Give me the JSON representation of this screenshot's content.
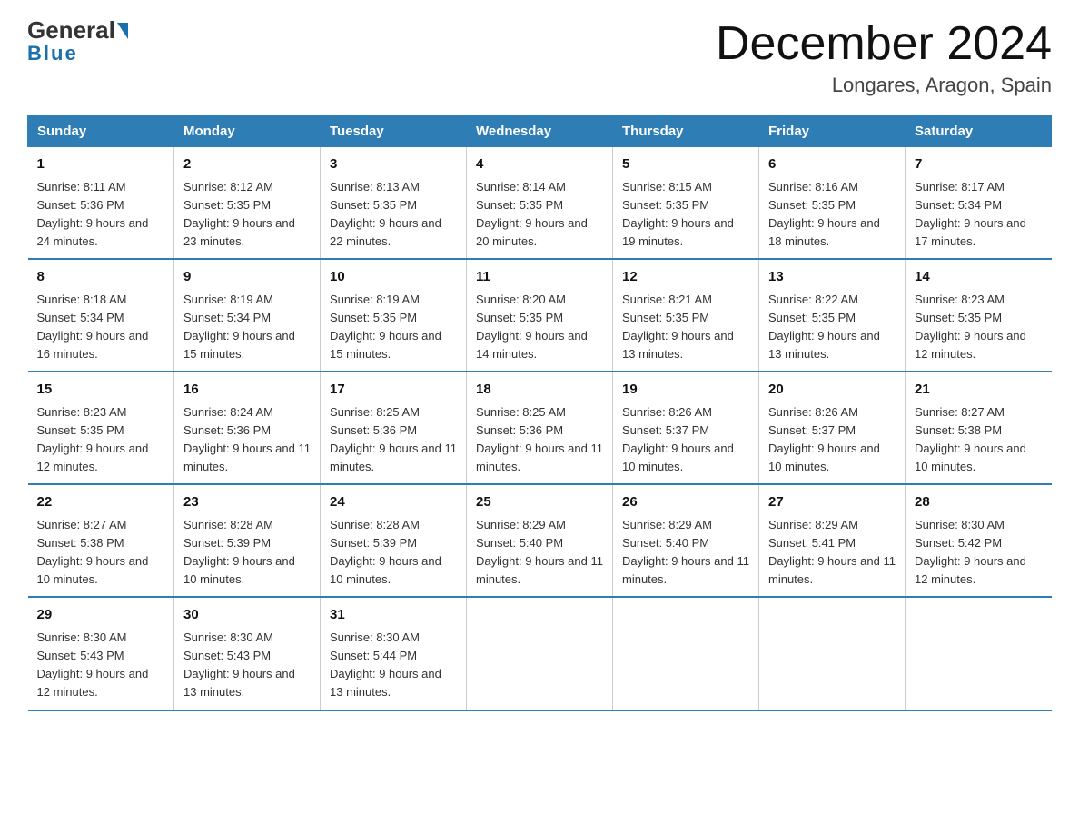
{
  "header": {
    "logo_general": "General",
    "logo_blue": "Blue",
    "title": "December 2024",
    "subtitle": "Longares, Aragon, Spain"
  },
  "days_of_week": [
    "Sunday",
    "Monday",
    "Tuesday",
    "Wednesday",
    "Thursday",
    "Friday",
    "Saturday"
  ],
  "weeks": [
    [
      {
        "day": "1",
        "sunrise": "8:11 AM",
        "sunset": "5:36 PM",
        "daylight": "9 hours and 24 minutes."
      },
      {
        "day": "2",
        "sunrise": "8:12 AM",
        "sunset": "5:35 PM",
        "daylight": "9 hours and 23 minutes."
      },
      {
        "day": "3",
        "sunrise": "8:13 AM",
        "sunset": "5:35 PM",
        "daylight": "9 hours and 22 minutes."
      },
      {
        "day": "4",
        "sunrise": "8:14 AM",
        "sunset": "5:35 PM",
        "daylight": "9 hours and 20 minutes."
      },
      {
        "day": "5",
        "sunrise": "8:15 AM",
        "sunset": "5:35 PM",
        "daylight": "9 hours and 19 minutes."
      },
      {
        "day": "6",
        "sunrise": "8:16 AM",
        "sunset": "5:35 PM",
        "daylight": "9 hours and 18 minutes."
      },
      {
        "day": "7",
        "sunrise": "8:17 AM",
        "sunset": "5:34 PM",
        "daylight": "9 hours and 17 minutes."
      }
    ],
    [
      {
        "day": "8",
        "sunrise": "8:18 AM",
        "sunset": "5:34 PM",
        "daylight": "9 hours and 16 minutes."
      },
      {
        "day": "9",
        "sunrise": "8:19 AM",
        "sunset": "5:34 PM",
        "daylight": "9 hours and 15 minutes."
      },
      {
        "day": "10",
        "sunrise": "8:19 AM",
        "sunset": "5:35 PM",
        "daylight": "9 hours and 15 minutes."
      },
      {
        "day": "11",
        "sunrise": "8:20 AM",
        "sunset": "5:35 PM",
        "daylight": "9 hours and 14 minutes."
      },
      {
        "day": "12",
        "sunrise": "8:21 AM",
        "sunset": "5:35 PM",
        "daylight": "9 hours and 13 minutes."
      },
      {
        "day": "13",
        "sunrise": "8:22 AM",
        "sunset": "5:35 PM",
        "daylight": "9 hours and 13 minutes."
      },
      {
        "day": "14",
        "sunrise": "8:23 AM",
        "sunset": "5:35 PM",
        "daylight": "9 hours and 12 minutes."
      }
    ],
    [
      {
        "day": "15",
        "sunrise": "8:23 AM",
        "sunset": "5:35 PM",
        "daylight": "9 hours and 12 minutes."
      },
      {
        "day": "16",
        "sunrise": "8:24 AM",
        "sunset": "5:36 PM",
        "daylight": "9 hours and 11 minutes."
      },
      {
        "day": "17",
        "sunrise": "8:25 AM",
        "sunset": "5:36 PM",
        "daylight": "9 hours and 11 minutes."
      },
      {
        "day": "18",
        "sunrise": "8:25 AM",
        "sunset": "5:36 PM",
        "daylight": "9 hours and 11 minutes."
      },
      {
        "day": "19",
        "sunrise": "8:26 AM",
        "sunset": "5:37 PM",
        "daylight": "9 hours and 10 minutes."
      },
      {
        "day": "20",
        "sunrise": "8:26 AM",
        "sunset": "5:37 PM",
        "daylight": "9 hours and 10 minutes."
      },
      {
        "day": "21",
        "sunrise": "8:27 AM",
        "sunset": "5:38 PM",
        "daylight": "9 hours and 10 minutes."
      }
    ],
    [
      {
        "day": "22",
        "sunrise": "8:27 AM",
        "sunset": "5:38 PM",
        "daylight": "9 hours and 10 minutes."
      },
      {
        "day": "23",
        "sunrise": "8:28 AM",
        "sunset": "5:39 PM",
        "daylight": "9 hours and 10 minutes."
      },
      {
        "day": "24",
        "sunrise": "8:28 AM",
        "sunset": "5:39 PM",
        "daylight": "9 hours and 10 minutes."
      },
      {
        "day": "25",
        "sunrise": "8:29 AM",
        "sunset": "5:40 PM",
        "daylight": "9 hours and 11 minutes."
      },
      {
        "day": "26",
        "sunrise": "8:29 AM",
        "sunset": "5:40 PM",
        "daylight": "9 hours and 11 minutes."
      },
      {
        "day": "27",
        "sunrise": "8:29 AM",
        "sunset": "5:41 PM",
        "daylight": "9 hours and 11 minutes."
      },
      {
        "day": "28",
        "sunrise": "8:30 AM",
        "sunset": "5:42 PM",
        "daylight": "9 hours and 12 minutes."
      }
    ],
    [
      {
        "day": "29",
        "sunrise": "8:30 AM",
        "sunset": "5:43 PM",
        "daylight": "9 hours and 12 minutes."
      },
      {
        "day": "30",
        "sunrise": "8:30 AM",
        "sunset": "5:43 PM",
        "daylight": "9 hours and 13 minutes."
      },
      {
        "day": "31",
        "sunrise": "8:30 AM",
        "sunset": "5:44 PM",
        "daylight": "9 hours and 13 minutes."
      },
      null,
      null,
      null,
      null
    ]
  ]
}
